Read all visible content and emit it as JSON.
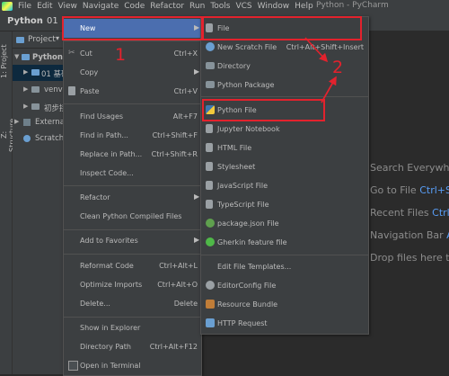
{
  "menubar": {
    "items": [
      "File",
      "Edit",
      "View",
      "Navigate",
      "Code",
      "Refactor",
      "Run",
      "Tools",
      "VCS",
      "Window",
      "Help"
    ],
    "window_title": "Python - PyCharm"
  },
  "navbar": {
    "crumb1": "Python",
    "crumb2": "01"
  },
  "left_strip": {
    "tab1": "1: Project",
    "tab2": "Z: Structure"
  },
  "project_panel": {
    "header": "Project",
    "rows": [
      "Python",
      "01 基础",
      "venv",
      "初步接",
      "External L",
      "Scratches"
    ]
  },
  "context_menu": {
    "new": "New",
    "cut": "Cut",
    "cut_sc": "Ctrl+X",
    "copy": "Copy",
    "paste": "Paste",
    "paste_sc": "Ctrl+V",
    "find_usages": "Find Usages",
    "find_usages_sc": "Alt+F7",
    "find_in_path": "Find in Path...",
    "find_in_path_sc": "Ctrl+Shift+F",
    "replace_in_path": "Replace in Path...",
    "replace_in_path_sc": "Ctrl+Shift+R",
    "inspect_code": "Inspect Code...",
    "refactor": "Refactor",
    "clean_compiled": "Clean Python Compiled Files",
    "add_to_favorites": "Add to Favorites",
    "reformat_code": "Reformat Code",
    "reformat_code_sc": "Ctrl+Alt+L",
    "optimize_imports": "Optimize Imports",
    "optimize_imports_sc": "Ctrl+Alt+O",
    "delete": "Delete...",
    "delete_sc": "Delete",
    "show_in_explorer": "Show in Explorer",
    "directory_path": "Directory Path",
    "directory_path_sc": "Ctrl+Alt+F12",
    "open_in_terminal": "Open in Terminal"
  },
  "new_submenu": {
    "file": "File",
    "new_scratch_file": "New Scratch File",
    "new_scratch_file_sc": "Ctrl+Alt+Shift+Insert",
    "directory": "Directory",
    "python_package": "Python Package",
    "python_file": "Python File",
    "jupyter_notebook": "Jupyter Notebook",
    "html_file": "HTML File",
    "stylesheet": "Stylesheet",
    "javascript_file": "JavaScript File",
    "typescript_file": "TypeScript File",
    "package_json": "package.json File",
    "gherkin": "Gherkin feature file",
    "edit_templates": "Edit File Templates...",
    "editorconfig": "EditorConfig File",
    "resource_bundle": "Resource Bundle",
    "http_request": "HTTP Request"
  },
  "editor_hints": {
    "search_everywhere": "Search Everywhere",
    "go_to_file": "Go to File",
    "go_to_file_key": "Ctrl+Sh",
    "recent_files": "Recent Files",
    "recent_files_key": "Ctrl+",
    "navigation_bar": "Navigation Bar",
    "navigation_bar_key": "Al",
    "drop_files": "Drop files here to"
  },
  "annotations": {
    "one": "1",
    "two": "2"
  },
  "colors": {
    "accent": "#4b6eaf",
    "annotation": "#e3222d"
  }
}
